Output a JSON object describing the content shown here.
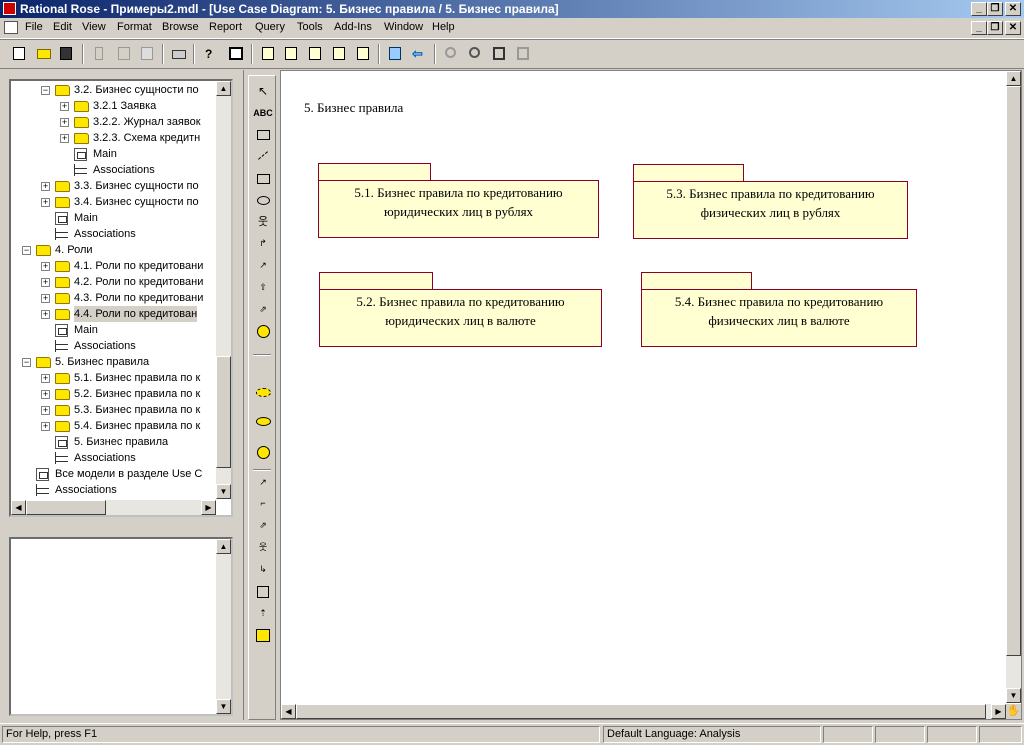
{
  "window": {
    "title": "Rational Rose - Примеры2.mdl - [Use Case Diagram: 5. Бизнес правила / 5. Бизнес правила]",
    "controls": [
      "_",
      "❐",
      "✕"
    ],
    "mdi_controls": [
      "_",
      "❐",
      "✕"
    ]
  },
  "menu": [
    "File",
    "Edit",
    "View",
    "Format",
    "Browse",
    "Report",
    "Query",
    "Tools",
    "Add-Ins",
    "Window",
    "Help"
  ],
  "toolbar_icons": [
    "new-icon",
    "open-icon",
    "save-icon",
    "cut-icon",
    "copy-icon",
    "paste-icon",
    "print-icon",
    "context-help-icon",
    "view-documentation-icon",
    "browse-class-diagram-icon",
    "browse-interaction-diagram-icon",
    "browse-component-diagram-icon",
    "browse-deployment-diagram-icon",
    "browse-parent-icon",
    "browse-previous-icon",
    "zoom-in-icon",
    "zoom-out-icon",
    "fit-in-window-icon",
    "undo-fit-icon"
  ],
  "tree": {
    "nodes": [
      {
        "label": "3.2. Бизнес сущности по",
        "kind": "folder",
        "expander": "−"
      },
      {
        "label": "3.2.1 Заявка",
        "kind": "folder",
        "expander": "+"
      },
      {
        "label": "3.2.2. Журнал заявок",
        "kind": "folder",
        "expander": "+"
      },
      {
        "label": "3.2.3. Схема кредитн",
        "kind": "folder",
        "expander": "+"
      },
      {
        "label": "Main",
        "kind": "diagram",
        "expander": ""
      },
      {
        "label": "Associations",
        "kind": "assoc",
        "expander": ""
      },
      {
        "label": "3.3. Бизнес сущности по",
        "kind": "folder",
        "expander": "+"
      },
      {
        "label": "3.4. Бизнес сущности по",
        "kind": "folder",
        "expander": "+"
      },
      {
        "label": "Main",
        "kind": "diagram",
        "expander": ""
      },
      {
        "label": "Associations",
        "kind": "assoc",
        "expander": ""
      },
      {
        "label": "4. Роли",
        "kind": "folder",
        "expander": "−"
      },
      {
        "label": "4.1. Роли по кредитовани",
        "kind": "folder",
        "expander": "+"
      },
      {
        "label": "4.2. Роли по кредитовани",
        "kind": "folder",
        "expander": "+"
      },
      {
        "label": "4.3. Роли по кредитовани",
        "kind": "folder",
        "expander": "+"
      },
      {
        "label": "4.4. Роли  по кредитован",
        "kind": "folder",
        "expander": "+",
        "selected": true
      },
      {
        "label": "Main",
        "kind": "diagram",
        "expander": ""
      },
      {
        "label": "Associations",
        "kind": "assoc",
        "expander": ""
      },
      {
        "label": "5. Бизнес правила",
        "kind": "folder",
        "expander": "−"
      },
      {
        "label": "5.1. Бизнес правила по к",
        "kind": "folder",
        "expander": "+"
      },
      {
        "label": "5.2. Бизнес правила по к",
        "kind": "folder",
        "expander": "+"
      },
      {
        "label": "5.3. Бизнес правила  по к",
        "kind": "folder",
        "expander": "+"
      },
      {
        "label": "5.4. Бизнес правила  по к",
        "kind": "folder",
        "expander": "+"
      },
      {
        "label": "5. Бизнес правила",
        "kind": "diagram",
        "expander": ""
      },
      {
        "label": "Associations",
        "kind": "assoc",
        "expander": ""
      },
      {
        "label": "Все модели в разделе Use C",
        "kind": "diagram",
        "expander": ""
      },
      {
        "label": "Associations",
        "kind": "assoc",
        "expander": ""
      }
    ]
  },
  "diagram": {
    "title": "5. Бизнес правила",
    "packages": [
      {
        "line1": "5.1. Бизнес правила по кредитованию",
        "line2": "юридических лиц в рублях"
      },
      {
        "line1": "5.3. Бизнес правила  по кредитованию",
        "line2": "физических  лиц в рублях"
      },
      {
        "line1": "5.2. Бизнес правила по кредитованию",
        "line2": "юридических лиц в валюте"
      },
      {
        "line1": "5.4. Бизнес правила  по кредитованию",
        "line2": "физических лиц в валюте"
      }
    ]
  },
  "toolbox": {
    "text_tool_label": "ABC"
  },
  "status": {
    "help": "For Help, press F1",
    "language": "Default Language: Analysis"
  },
  "colors": {
    "title_start": "#0a246a",
    "title_end": "#a6caf0",
    "package_fill": "#ffffd2",
    "package_border": "#8b0028",
    "folder": "#ffe600"
  }
}
